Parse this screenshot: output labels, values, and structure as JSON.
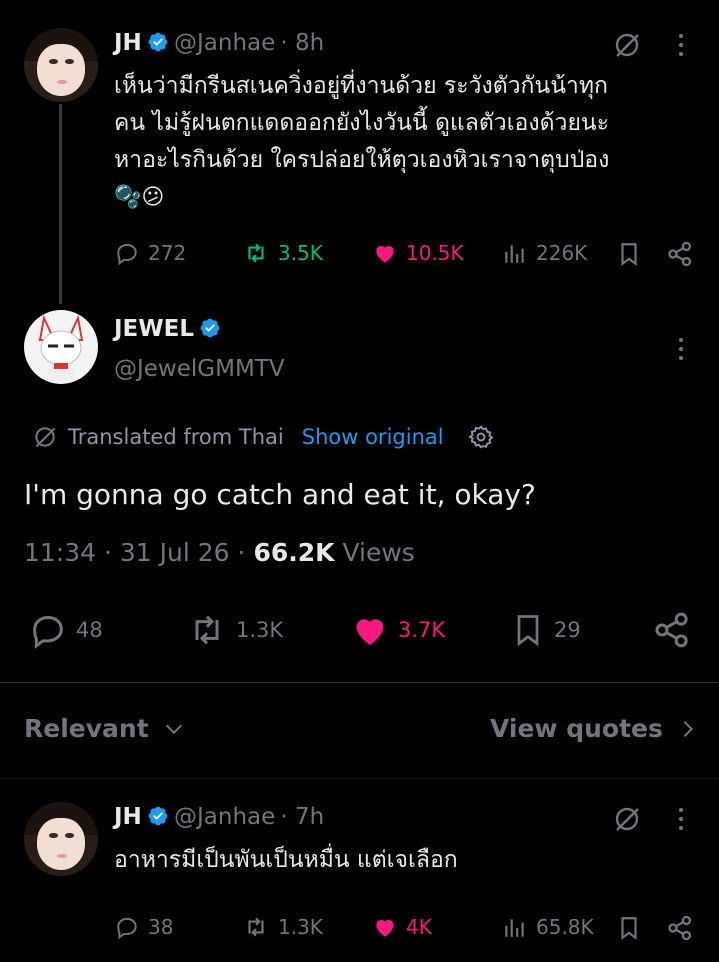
{
  "colors": {
    "background": "#000000",
    "text": "#e7e9ea",
    "muted": "#71767b",
    "link": "#1d9bf0",
    "like": "#f91880",
    "retweet": "#00ba7c"
  },
  "tweet1": {
    "name": "JH",
    "handle": "@Janhae",
    "time": "· 8h",
    "lines": [
      "เห็นว่ามีกรีนสเนควิ่งอยู่ที่งานด้วย ระวังตัวกันน้าทุก",
      "คน ไม่รู้ฝนตกแดดออกยังไงวันนี้ ดูแลตัวเองด้วยนะ",
      "หาอะไรกินด้วย ใครปล่อยให้ตุวเองหิวเราจาตุบป่อง"
    ],
    "emoji": "🫧😕",
    "replies": "272",
    "retweets": "3.5K",
    "likes": "10.5K",
    "views": "226K"
  },
  "main_tweet": {
    "name": "JEWEL",
    "handle": "@JewelGMMTV",
    "translated_label": "Translated from Thai",
    "show_original": "Show original",
    "text": "I'm gonna go catch and eat it, okay?",
    "time": "11:34",
    "date": "31 Jul 26",
    "views_count": "66.2K",
    "views_label": "Views",
    "replies": "48",
    "retweets": "1.3K",
    "likes": "3.7K",
    "bookmarks": "29"
  },
  "sort": {
    "label": "Relevant",
    "quotes_label": "View quotes"
  },
  "reply1": {
    "name": "JH",
    "handle": "@Janhae",
    "time": "· 7h",
    "text": "อาหารมีเป็นพันเป็นหมื่น แต่เจเลือก",
    "replies": "38",
    "retweets": "1.3K",
    "likes": "4K",
    "views": "65.8K"
  }
}
